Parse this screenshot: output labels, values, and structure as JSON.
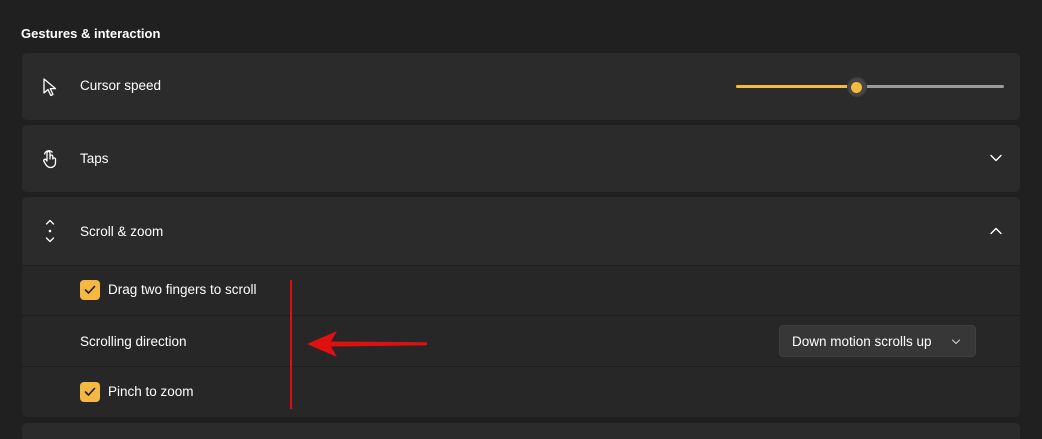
{
  "section_title": "Gestures & interaction",
  "cursor_speed": {
    "label": "Cursor speed",
    "icon": "cursor-arrow-icon",
    "slider_value_fraction": 0.45,
    "accent_color": "#f5b942"
  },
  "taps": {
    "label": "Taps",
    "icon": "tap-hand-icon",
    "expanded": false
  },
  "scroll_zoom": {
    "label": "Scroll & zoom",
    "icon": "scroll-arrows-icon",
    "expanded": true,
    "drag_two_fingers": {
      "label": "Drag two fingers to scroll",
      "checked": true
    },
    "scrolling_direction": {
      "label": "Scrolling direction",
      "value": "Down motion scrolls up"
    },
    "pinch_to_zoom": {
      "label": "Pinch to zoom",
      "checked": true
    }
  },
  "annotation_color": "#e01010"
}
